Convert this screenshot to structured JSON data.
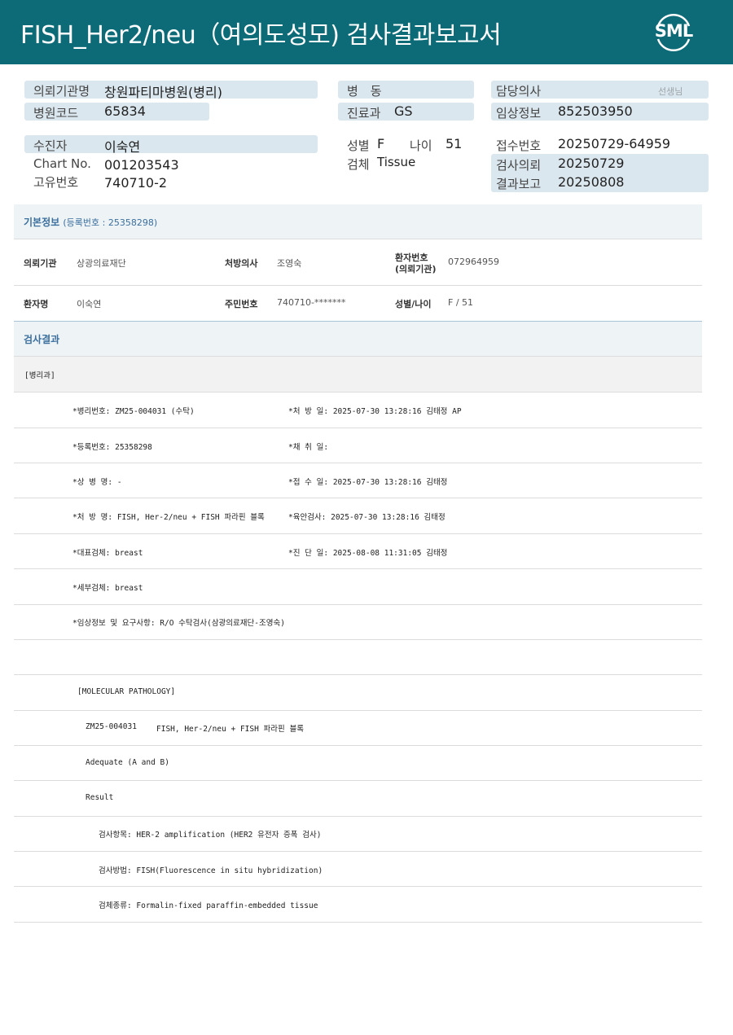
{
  "header": {
    "title": "FISH_Her2/neu（여의도성모) 검사결과보고서",
    "logo_text": "SML"
  },
  "summary": {
    "requesting_org_label": "의뢰기관명",
    "requesting_org_value": "창원파티마병원(병리)",
    "hospital_code_label": "병원코드",
    "hospital_code_value": "65834",
    "ward_label": "병　동",
    "department_label": "진료과",
    "department_value": "GS",
    "doctor_label": "담당의사",
    "doctor_suffix": "선생님",
    "clinical_info_label": "임상정보",
    "clinical_info_value": "852503950",
    "patient_label": "수진자",
    "patient_value": "이숙연",
    "chart_label": "Chart No.",
    "chart_value": "001203543",
    "unique_label": "고유번호",
    "unique_value": "740710-2",
    "sex_label": "성별",
    "sex_value": "F",
    "age_label": "나이",
    "age_value": "51",
    "specimen_label": "검체",
    "specimen_value": "Tissue",
    "receipt_label": "접수번호",
    "receipt_value": "20250729-64959",
    "test_request_label": "검사의뢰",
    "test_request_value": "20250729",
    "result_report_label": "결과보고",
    "result_report_value": "20250808"
  },
  "basic_info": {
    "title": "기본정보",
    "reg_no": "(등록번호 : 25358298)",
    "org_label": "의뢰기관",
    "org_value": "상광의료재단",
    "prescriber_label": "처방의사",
    "prescriber_value": "조영숙",
    "patient_no_label_1": "환자번호",
    "patient_no_label_2": "(의뢰기관)",
    "patient_no_value": "072964959",
    "patient_name_label": "환자명",
    "patient_name_value": "이숙연",
    "resident_no_label": "주민번호",
    "resident_no_value": "740710-*******",
    "sex_age_label": "성별/나이",
    "sex_age_value": "F / 51"
  },
  "results": {
    "title": "검사결과",
    "dept": "[병리과]",
    "rows": [
      {
        "left": "*병리번호: ZM25-004031 (수탁)",
        "right": "*처 방 일: 2025-07-30 13:28:16  김태정 AP"
      },
      {
        "left": "*등록번호: 25358298",
        "right": "*채 취 일:"
      },
      {
        "left": "*상 병 명: -",
        "right": "*접 수 일: 2025-07-30 13:28:16  김태정"
      },
      {
        "left": "*처 방 명: FISH, Her-2/neu + FISH 파라핀 블록",
        "right": "*육안검사: 2025-07-30 13:28:16  김태정"
      },
      {
        "left": "*대표검체: breast",
        "right": "*진 단 일: 2025-08-08 11:31:05  김태정"
      },
      {
        "left": "*세부검체: breast",
        "right": ""
      },
      {
        "left": "*임상정보 및 요구사항: R/O 수탁검사(삼광의료재단-조영숙)",
        "right": ""
      }
    ],
    "molecular_header": "[MOLECULAR PATHOLOGY]",
    "case_no": "ZM25-004031",
    "case_test": "FISH, Her-2/neu + FISH 파라핀 블록",
    "adequacy": "Adequate (A and B)",
    "result_label": "Result",
    "test_item": "검사항목: HER-2 amplification (HER2 유전자 증폭 검사)",
    "test_method": "검사방법: FISH(Fluorescence in situ hybridization)",
    "specimen_type": "검체종류: Formalin-fixed paraffin-embedded tissue"
  }
}
